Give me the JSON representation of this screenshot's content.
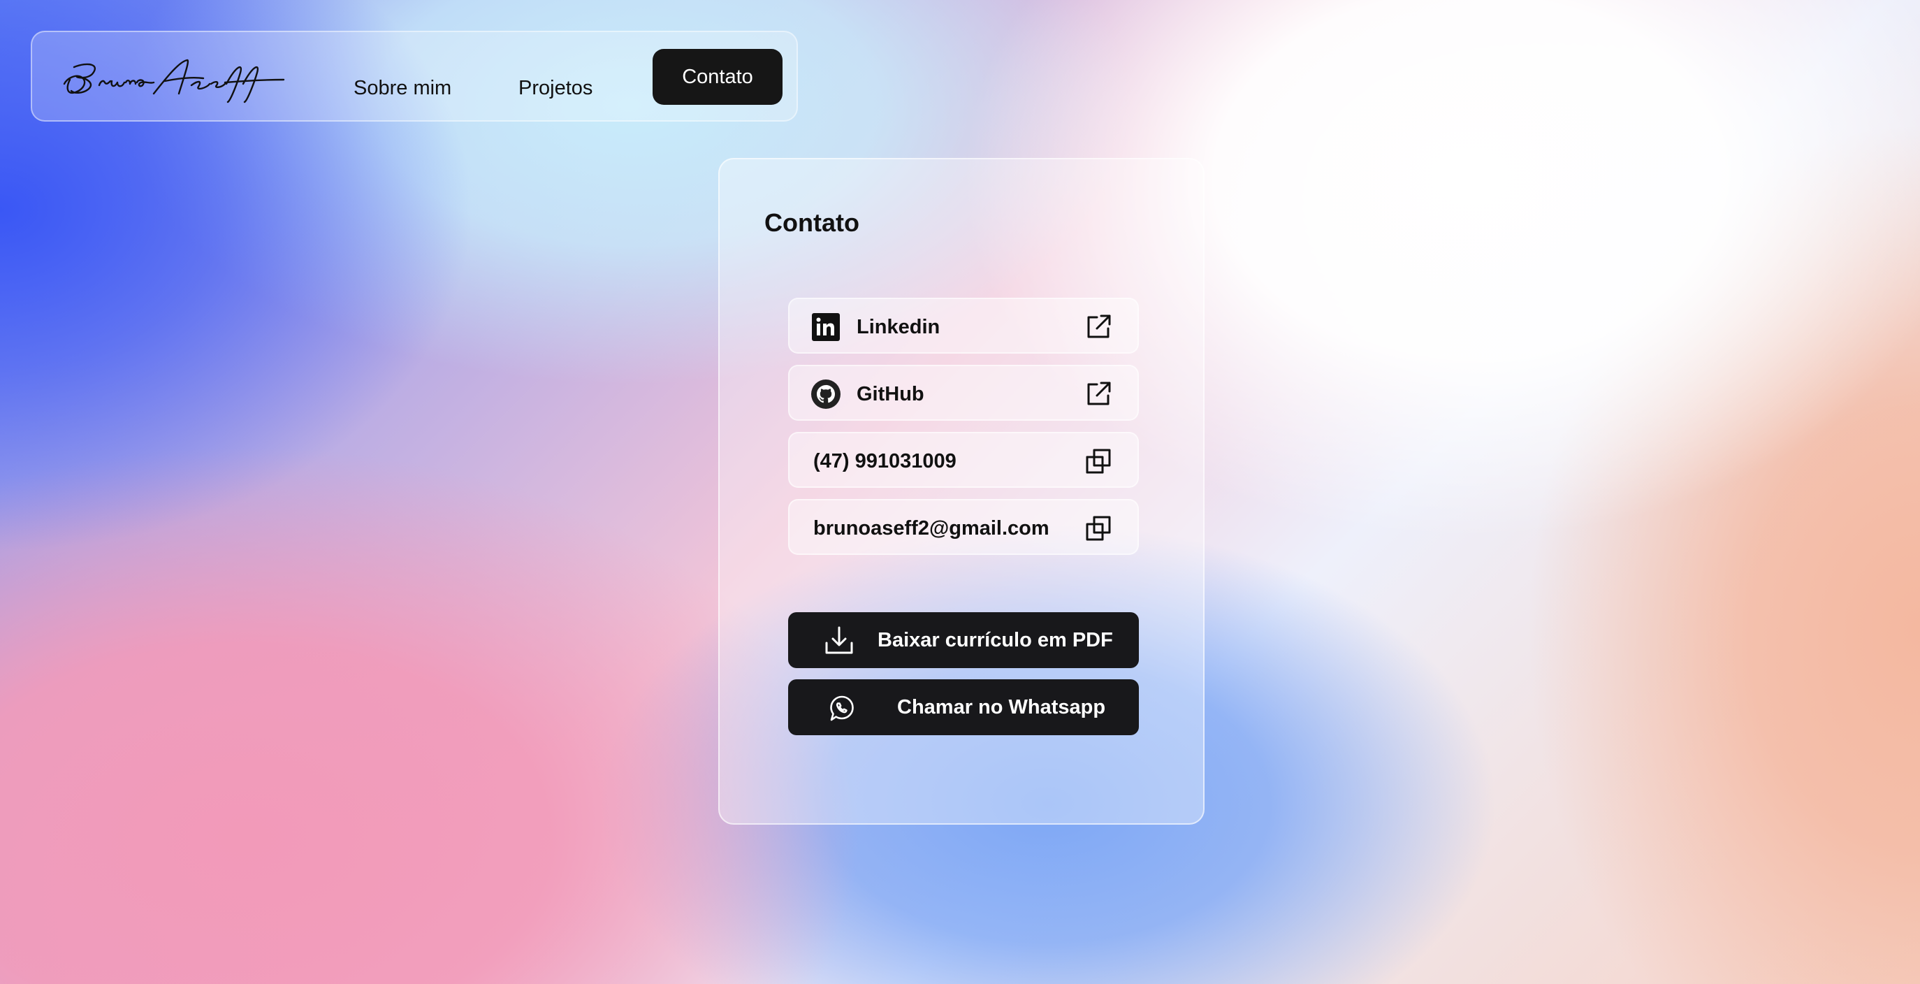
{
  "nav": {
    "logo_text": "Bruno Aseff",
    "links": [
      {
        "label": "Sobre mim"
      },
      {
        "label": "Projetos"
      }
    ],
    "cta_label": "Contato"
  },
  "contact": {
    "title": "Contato",
    "items": [
      {
        "label": "Linkedin",
        "icon": "linkedin-icon",
        "action_icon": "external-link-icon"
      },
      {
        "label": "GitHub",
        "icon": "github-icon",
        "action_icon": "external-link-icon"
      },
      {
        "label": "(47) 991031009",
        "action_icon": "copy-icon"
      },
      {
        "label": "brunoaseff2@gmail.com",
        "action_icon": "copy-icon"
      }
    ],
    "buttons": [
      {
        "label": "Baixar currículo em PDF",
        "icon": "download-icon"
      },
      {
        "label": "Chamar no Whatsapp",
        "icon": "whatsapp-icon"
      }
    ]
  },
  "colors": {
    "button_bg": "#18181b",
    "text": "#111111"
  }
}
